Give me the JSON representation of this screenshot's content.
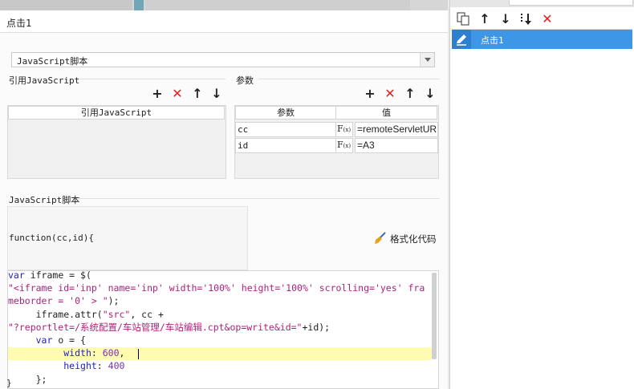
{
  "title": "点击1",
  "script_type": {
    "selected": "JavaScript脚本"
  },
  "ref_js": {
    "group_label": "引用JavaScript",
    "column_header": "引用JavaScript"
  },
  "params": {
    "group_label": "参数",
    "col_param": "参数",
    "col_value": "值",
    "fx_label": "F(x)",
    "rows": [
      {
        "name": "cc",
        "value": "=remoteServletUR"
      },
      {
        "name": "id",
        "value": "=A3"
      }
    ]
  },
  "script_section": {
    "group_label": "JavaScript脚本",
    "signature": "function(cc,id){",
    "format_button": "格式化代码",
    "closing_brace": "}"
  },
  "code": {
    "lines": [
      [
        [
          "kw",
          "var"
        ],
        [
          "t",
          " iframe = $("
        ]
      ],
      [
        [
          "str",
          "\"<iframe id='inp' name='inp' width='100%' height='100%' scrolling='yes' fra"
        ]
      ],
      [
        [
          "str",
          "meborder = '0' > \""
        ],
        [
          "t",
          ");"
        ]
      ],
      [
        [
          "t",
          "     iframe.attr("
        ],
        [
          "str",
          "\"src\""
        ],
        [
          "t",
          ", cc +"
        ]
      ],
      [
        [
          "str",
          "\"?reportlet=/系统配置/车站管理/车站编辑.cpt&op=write&id=\""
        ],
        [
          "t",
          "+id);"
        ]
      ],
      [
        [
          "t",
          "     "
        ],
        [
          "kw",
          "var"
        ],
        [
          "t",
          " o = {"
        ]
      ],
      [
        [
          "t",
          "          "
        ],
        [
          "kw",
          "width"
        ],
        [
          "t",
          ": "
        ],
        [
          "num",
          "600"
        ],
        [
          "t",
          ","
        ]
      ],
      [
        [
          "t",
          "          "
        ],
        [
          "kw",
          "height"
        ],
        [
          "t",
          ": "
        ],
        [
          "num",
          "400"
        ]
      ],
      [
        [
          "t",
          "     };"
        ]
      ]
    ]
  },
  "right_panel": {
    "items": [
      {
        "label": "点击1",
        "selected": true
      }
    ]
  },
  "icons": {
    "add": "plus-icon",
    "delete": "red-x-icon",
    "up": "arrow-up-icon",
    "down": "arrow-down-icon",
    "copy": "copy-icon",
    "pencil": "pencil-icon",
    "broom": "broom-icon"
  },
  "colors": {
    "selection": "#3d97e6",
    "delete_red": "#e02020",
    "current_line": "#fffbb0",
    "keyword": "#1f1fb5",
    "string": "#b0207a"
  }
}
